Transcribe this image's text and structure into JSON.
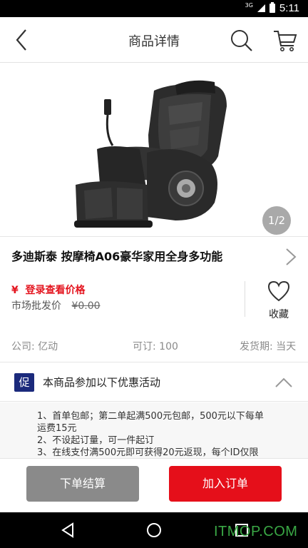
{
  "status_bar": {
    "network": "3G",
    "time": "5:11"
  },
  "header": {
    "title": "商品详情",
    "icons": [
      "back-arrow-icon",
      "search-icon",
      "cart-icon"
    ]
  },
  "gallery": {
    "pager": "1/2",
    "image": "massage-chair"
  },
  "product": {
    "title": "多迪斯泰 按摩椅A06豪华家用全身多功能",
    "price_label": "¥  登录查看价格",
    "market_label": "市场批发价",
    "market_price": "¥0.00",
    "favorite_label": "收藏"
  },
  "meta": {
    "company": "公司: 亿动",
    "min_order": "可订: 100",
    "shipping": "发货期: 当天"
  },
  "promo": {
    "badge": "促",
    "title": "本商品参加以下优惠活动",
    "lines": [
      "1、首单包邮；第二单起满500元包邮，500元以下每单",
      "运费15元",
      "2、不设起订量，可一件起订",
      "3、在线支付满500元即可获得20元返现，每个ID仅限"
    ]
  },
  "actions": {
    "checkout": "下单结算",
    "add_to_order": "加入订单"
  },
  "watermark": "ITMOP.COM",
  "colors": {
    "accent_red": "#e50f1a",
    "promo_badge": "#1b2a7c",
    "checkout_gray": "#8a8a8a"
  }
}
